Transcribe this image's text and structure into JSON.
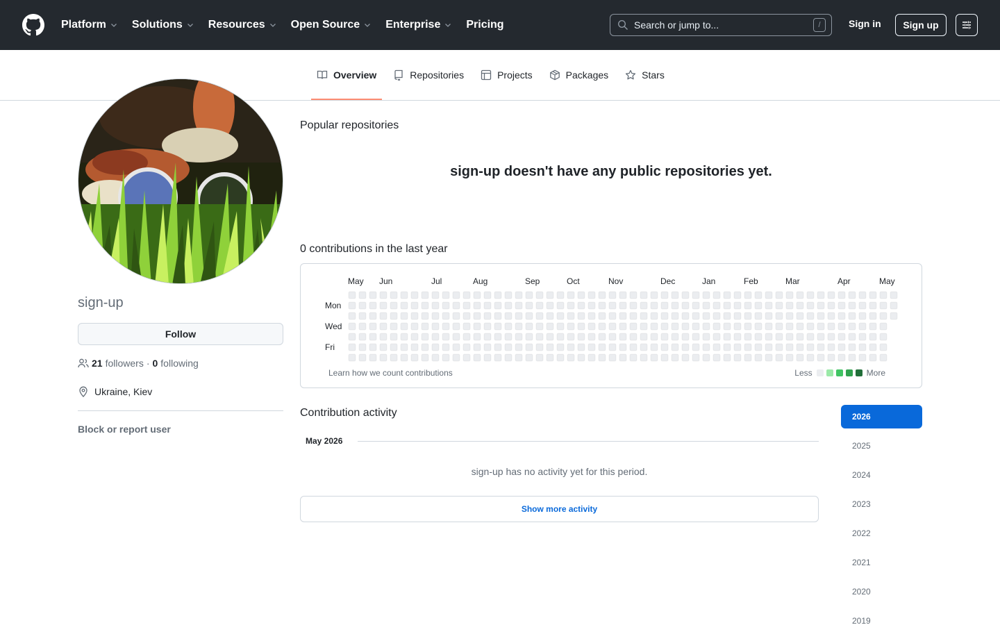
{
  "header": {
    "nav": [
      {
        "label": "Platform",
        "dropdown": true
      },
      {
        "label": "Solutions",
        "dropdown": true
      },
      {
        "label": "Resources",
        "dropdown": true
      },
      {
        "label": "Open Source",
        "dropdown": true
      },
      {
        "label": "Enterprise",
        "dropdown": true
      },
      {
        "label": "Pricing",
        "dropdown": false
      }
    ],
    "search_placeholder": "Search or jump to...",
    "search_shortcut": "/",
    "sign_in": "Sign in",
    "sign_up": "Sign up"
  },
  "tabs": [
    {
      "label": "Overview",
      "icon": "book-icon",
      "active": true
    },
    {
      "label": "Repositories",
      "icon": "repo-icon",
      "active": false
    },
    {
      "label": "Projects",
      "icon": "table-icon",
      "active": false
    },
    {
      "label": "Packages",
      "icon": "package-icon",
      "active": false
    },
    {
      "label": "Stars",
      "icon": "star-icon",
      "active": false
    }
  ],
  "profile": {
    "username": "sign-up",
    "follow_label": "Follow",
    "followers_count": "21",
    "followers_label": "followers",
    "separator": "·",
    "following_count": "0",
    "following_label": "following",
    "location": "Ukraine, Kiev",
    "block_label": "Block or report user"
  },
  "main": {
    "popular_title": "Popular repositories",
    "no_repos": "sign-up doesn't have any public repositories yet.",
    "contributions_title": "0 contributions in the last year",
    "calendar": {
      "months": [
        "May",
        "Jun",
        "Jul",
        "Aug",
        "Sep",
        "Oct",
        "Nov",
        "Dec",
        "Jan",
        "Feb",
        "Mar",
        "Apr",
        "May"
      ],
      "days": [
        "Mon",
        "Wed",
        "Fri"
      ],
      "learn_link": "Learn how we count contributions",
      "legend_less": "Less",
      "legend_more": "More",
      "legend_colors": [
        "#ebedf0",
        "#9be9a8",
        "#40c463",
        "#30a14e",
        "#216e39"
      ],
      "empty_color": "#ebedf0",
      "weeks": 53,
      "last_week_days": 3,
      "contributions": 0
    },
    "activity_title": "Contribution activity",
    "month_heading": "May 2026",
    "no_activity": "sign-up has no activity yet for this period.",
    "show_more": "Show more activity",
    "years": [
      {
        "label": "2026",
        "active": true
      },
      {
        "label": "2025",
        "active": false
      },
      {
        "label": "2024",
        "active": false
      },
      {
        "label": "2023",
        "active": false
      },
      {
        "label": "2022",
        "active": false
      },
      {
        "label": "2021",
        "active": false
      },
      {
        "label": "2020",
        "active": false
      },
      {
        "label": "2019",
        "active": false
      }
    ]
  },
  "colors": {
    "header_bg": "#24292f",
    "accent_tab": "#fd8c73",
    "link_blue": "#0969da"
  }
}
